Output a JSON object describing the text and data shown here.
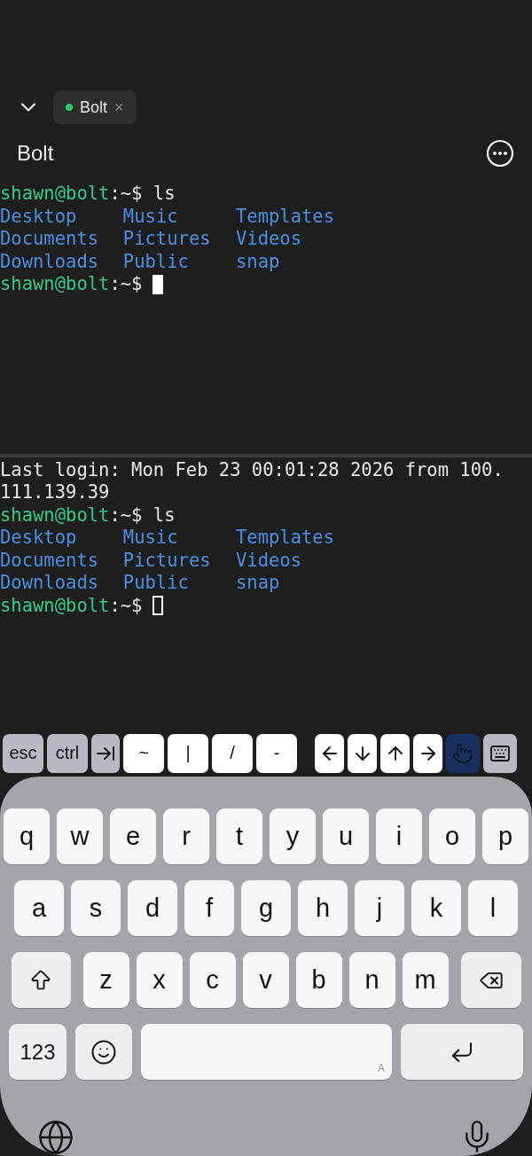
{
  "tab_bar": {
    "tabs": [
      {
        "label": "Bolt",
        "color": "#2ecc71",
        "selected": true,
        "close": "×"
      }
    ]
  },
  "title": "Bolt",
  "panes": [
    {
      "focused": true,
      "lines": [
        {
          "kind": "prompt",
          "user": "shawn@bolt",
          "text": ":~$ ls"
        },
        {
          "kind": "listing",
          "columns": [
            "Desktop",
            "Music",
            "Templates"
          ]
        },
        {
          "kind": "listing",
          "columns": [
            "Documents",
            "Pictures",
            "Videos"
          ]
        },
        {
          "kind": "listing",
          "columns": [
            "Downloads",
            "Public",
            "snap"
          ]
        },
        {
          "kind": "prompt",
          "user": "shawn@bolt",
          "text": ":~$"
        }
      ]
    },
    {
      "focused": false,
      "lines": [
        {
          "kind": "text",
          "text": "Last login: Mon Feb 23 00:01:28 2026 from 100."
        },
        {
          "kind": "text",
          "text": "111.139.39"
        },
        {
          "kind": "prompt",
          "user": "shawn@bolt",
          "text": ":~$ ls"
        },
        {
          "kind": "listing",
          "columns": [
            "Desktop",
            "Music",
            "Templates"
          ]
        },
        {
          "kind": "listing",
          "columns": [
            "Documents",
            "Pictures",
            "Videos"
          ]
        },
        {
          "kind": "listing",
          "columns": [
            "Downloads",
            "Public",
            "snap"
          ]
        },
        {
          "kind": "prompt",
          "user": "shawn@bolt",
          "text": ":~$"
        }
      ]
    }
  ],
  "accessory_keys": [
    {
      "kind": "text",
      "label": "esc",
      "modifier": true,
      "selected": false
    },
    {
      "kind": "text",
      "label": "ctrl",
      "modifier": true,
      "selected": false
    },
    {
      "kind": "icon",
      "modifier": true,
      "selected": false
    },
    {
      "kind": "text",
      "label": "~",
      "modifier": false,
      "selected": false
    },
    {
      "kind": "text",
      "label": "|",
      "modifier": false,
      "selected": false
    },
    {
      "kind": "text",
      "label": "/",
      "modifier": false,
      "selected": false
    },
    {
      "kind": "text",
      "label": "-",
      "modifier": false,
      "selected": false
    },
    {
      "kind": "icon",
      "modifier": false,
      "selected": false
    },
    {
      "kind": "icon",
      "modifier": false,
      "selected": false
    },
    {
      "kind": "icon",
      "modifier": false,
      "selected": false
    },
    {
      "kind": "icon",
      "modifier": false,
      "selected": false
    },
    {
      "kind": "icon",
      "modifier": true,
      "selected": true
    },
    {
      "kind": "icon",
      "modifier": true,
      "selected": false
    }
  ],
  "keyboard": {
    "rows": [
      [
        "q",
        "w",
        "e",
        "r",
        "t",
        "y",
        "u",
        "i",
        "o",
        "p"
      ],
      [
        "a",
        "s",
        "d",
        "f",
        "g",
        "h",
        "j",
        "k",
        "l"
      ],
      [
        "z",
        "x",
        "c",
        "v",
        "b",
        "n",
        "m"
      ]
    ],
    "numbers_key": "123",
    "space_hint": "A"
  }
}
